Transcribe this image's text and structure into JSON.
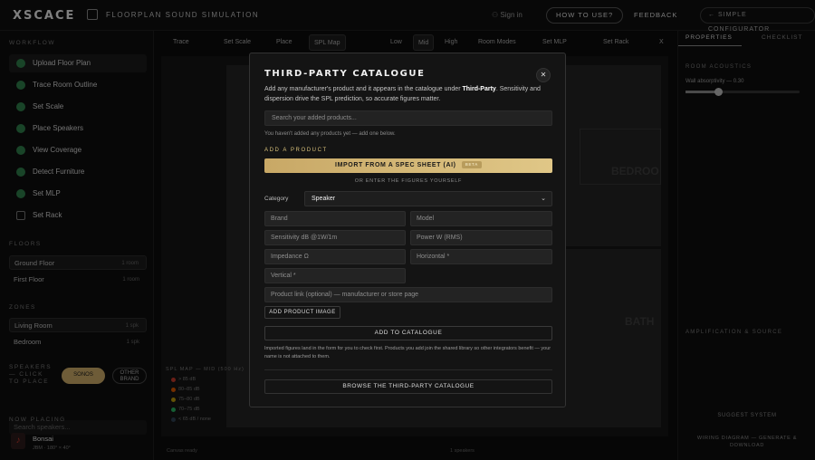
{
  "app": {
    "logo": "XSCACE",
    "title": "FLOORPLAN SOUND SIMULATION",
    "sign_in": "Sign in",
    "how_to": "HOW TO USE?",
    "feedback": "FEEDBACK",
    "simple_config": "SIMPLE CONFIGURATOR"
  },
  "sidebar": {
    "workflow_heading": "WORKFLOW",
    "steps": [
      "Upload Floor Plan",
      "Trace Room Outline",
      "Set Scale",
      "Place Speakers",
      "View Coverage",
      "Detect Furniture",
      "Set MLP",
      "Set Rack"
    ],
    "floors_heading": "FLOORS",
    "floors": [
      {
        "name": "Ground Floor",
        "meta": "1 room"
      },
      {
        "name": "First Floor",
        "meta": "1 room"
      }
    ],
    "zones_heading": "ZONES",
    "zones": [
      {
        "name": "Living Room",
        "meta": "1 spk"
      },
      {
        "name": "Bedroom",
        "meta": "1 spk"
      }
    ],
    "speakers_heading": "SPEAKERS — CLICK TO PLACE",
    "brand_chip": "SONOS",
    "other_chip": "OTHER BRAND",
    "search_placeholder": "Search speakers...",
    "now_placing": "NOW PLACING",
    "current_speaker": {
      "name": "Bonsai",
      "meta": "JBM · 180° × 40°"
    }
  },
  "toolbar": {
    "items": [
      "Trace",
      "Set Scale",
      "Place",
      "SPL Map",
      "Low",
      "Mid",
      "High",
      "Room Modes",
      "Set MLP",
      "Set Rack",
      "X"
    ]
  },
  "canvas": {
    "rooms": [
      "BEDROO",
      "BATH"
    ],
    "legend_title": "SPL MAP — MID (500 Hz)",
    "legend": [
      {
        "label": "> 85 dB",
        "color": "#c0392b"
      },
      {
        "label": "80–85 dB",
        "color": "#d35400"
      },
      {
        "label": "75–80 dB",
        "color": "#b7950b"
      },
      {
        "label": "70–75 dB",
        "color": "#27ae60"
      },
      {
        "label": "< 65 dB / none",
        "color": "#2e4053"
      }
    ],
    "status": "Canvas ready",
    "status_count": "1 speakers"
  },
  "rightpanel": {
    "tab_properties": "PROPERTIES",
    "tab_checklist": "CHECKLIST",
    "room_acoustics": "ROOM ACOUSTICS",
    "wall_absorptivity": "Wall absorptivity — 0.30",
    "amp_heading": "AMPLIFICATION & SOURCE",
    "budget": "SUGGEST SYSTEM",
    "wiring": "WIRING DIAGRAM — GENERATE & DOWNLOAD"
  },
  "modal": {
    "title": "THIRD-PARTY CATALOGUE",
    "description_before": "Add any manufacturer's product and it appears in the catalogue under ",
    "description_strong": "Third-Party",
    "description_after": ". Sensitivity and dispersion drive the SPL prediction, so accurate figures matter.",
    "search_placeholder": "Search your added products...",
    "empty_text": "You haven't added any products yet — add one below.",
    "add_heading": "ADD A PRODUCT",
    "import_button": "IMPORT FROM A SPEC SHEET (AI)",
    "import_tag": "BETA",
    "or_text": "OR ENTER THE FIGURES YOURSELF",
    "category_label": "Category",
    "category_value": "Speaker",
    "fields": {
      "brand": "Brand",
      "model": "Model",
      "sensitivity": "Sensitivity dB @1W/1m",
      "power": "Power W (RMS)",
      "impedance": "Impedance Ω",
      "horizontal": "Horizontal *",
      "vertical": "Vertical *",
      "link": "Product link (optional) — manufacturer or store page"
    },
    "add_image": "ADD PRODUCT IMAGE",
    "add_to_catalogue": "ADD TO CATALOGUE",
    "note": "Imported figures land in the form for you to check first. Products you add join the shared library so other integrators benefit — your name is not attached to them.",
    "browse": "BROWSE THE THIRD-PARTY CATALOGUE"
  }
}
